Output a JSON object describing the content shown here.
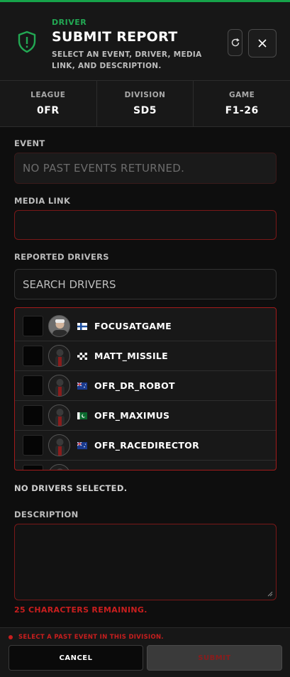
{
  "header": {
    "role": "DRIVER",
    "title": "SUBMIT REPORT",
    "subtitle": "SELECT AN EVENT, DRIVER, MEDIA LINK, AND DESCRIPTION.",
    "icon": "shield-alert-icon",
    "accent": "#16a34a"
  },
  "stats": [
    {
      "label": "LEAGUE",
      "value": "0FR"
    },
    {
      "label": "DIVISION",
      "value": "SD5"
    },
    {
      "label": "GAME",
      "value": "F1-26"
    }
  ],
  "event": {
    "label": "EVENT",
    "placeholder": "NO PAST EVENTS RETURNED."
  },
  "media": {
    "label": "MEDIA LINK",
    "value": ""
  },
  "drivers": {
    "label": "REPORTED DRIVERS",
    "search_placeholder": "SEARCH DRIVERS",
    "items": [
      {
        "name": "FOCUSATGAME",
        "flag": "finland-flag"
      },
      {
        "name": "MATT_MISSILE",
        "flag": "checkered-flag"
      },
      {
        "name": "OFR_DR_ROBOT",
        "flag": "australia-flag"
      },
      {
        "name": "OFR_MAXIMUS",
        "flag": "pakistan-flag"
      },
      {
        "name": "OFR_RACEDIRECTOR",
        "flag": "australia-flag"
      }
    ],
    "none_selected": "NO DRIVERS SELECTED."
  },
  "description": {
    "label": "DESCRIPTION",
    "value": "",
    "remaining": "25 CHARACTERS REMAINING."
  },
  "footer": {
    "error": "SELECT A PAST EVENT IN THIS DIVISION.",
    "cancel_label": "CANCEL",
    "submit_label": "SUBMIT",
    "error_color": "#c81e1e"
  }
}
